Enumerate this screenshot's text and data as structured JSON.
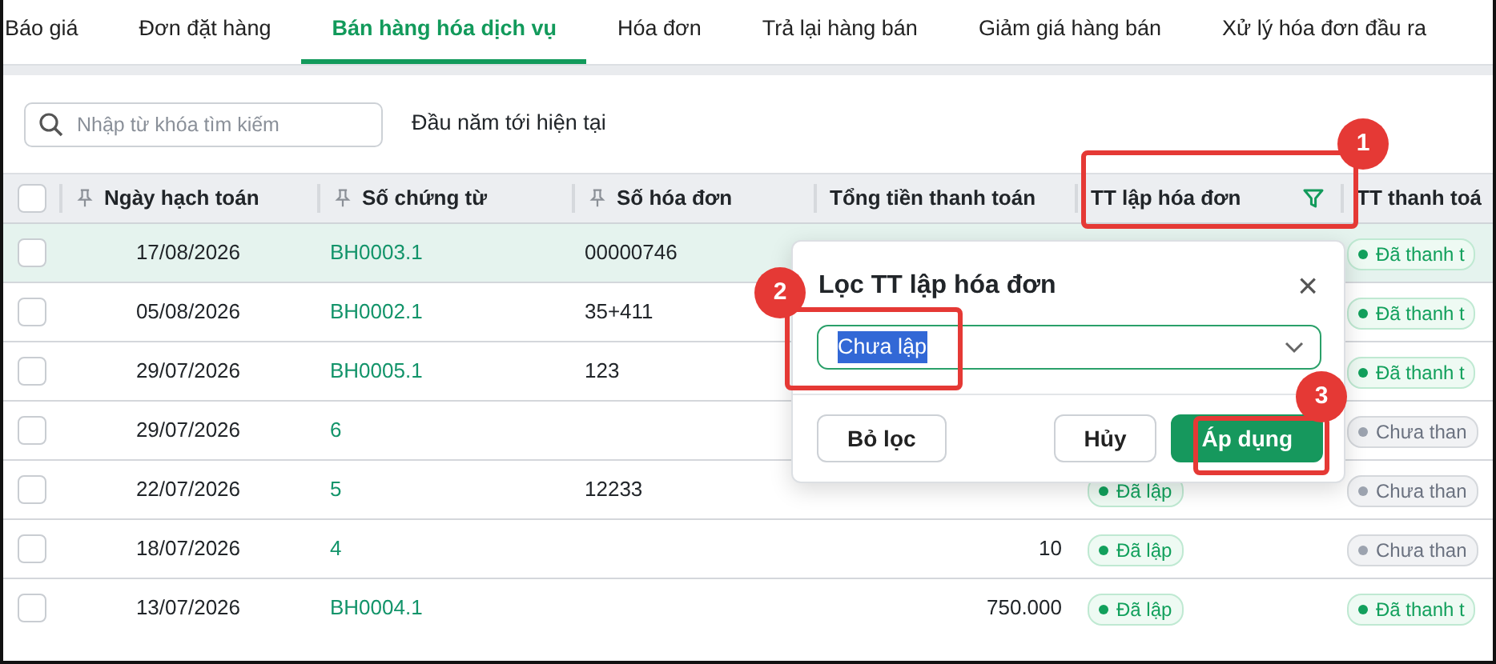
{
  "tabs": [
    {
      "label": "Báo giá",
      "selected": false
    },
    {
      "label": "Đơn đặt hàng",
      "selected": false
    },
    {
      "label": "Bán hàng hóa dịch vụ",
      "selected": true
    },
    {
      "label": "Hóa đơn",
      "selected": false
    },
    {
      "label": "Trả lại hàng bán",
      "selected": false
    },
    {
      "label": "Giảm giá hàng bán",
      "selected": false
    },
    {
      "label": "Xử lý hóa đơn đầu ra",
      "selected": false
    }
  ],
  "search": {
    "placeholder": "Nhập từ khóa tìm kiếm"
  },
  "period": "Đầu năm tới hiện tại",
  "table": {
    "select_all_checked": false,
    "columns": [
      {
        "label": "Ngày hạch toán",
        "pinned": true,
        "filtered": false
      },
      {
        "label": "Số chứng từ",
        "pinned": true,
        "filtered": false
      },
      {
        "label": "Số hóa đơn",
        "pinned": true,
        "filtered": false
      },
      {
        "label": "Tổng tiền thanh toán",
        "pinned": false,
        "filtered": false
      },
      {
        "label": "TT lập hóa đơn",
        "pinned": false,
        "filtered": true
      },
      {
        "label": "TT thanh toá",
        "pinned": false,
        "filtered": false
      }
    ],
    "rows": [
      {
        "selected": true,
        "checked": false,
        "date": "17/08/2026",
        "voucher": "BH0003.1",
        "invoice_no": "00000746",
        "payment": {
          "text": "Đã thanh t",
          "color": "#12a05c"
        }
      },
      {
        "selected": false,
        "checked": false,
        "date": "05/08/2026",
        "voucher": "BH0002.1",
        "invoice_no": "35+411",
        "payment": {
          "text": "Đã thanh t",
          "color": "#12a05c"
        }
      },
      {
        "selected": false,
        "checked": false,
        "date": "29/07/2026",
        "voucher": "BH0005.1",
        "invoice_no": "123",
        "payment": {
          "text": "Đã thanh t",
          "color": "#12a05c"
        }
      },
      {
        "selected": false,
        "checked": false,
        "date": "29/07/2026",
        "voucher": "6",
        "payment": {
          "text": "Chưa than",
          "color": "#9ca3af"
        }
      },
      {
        "selected": false,
        "checked": false,
        "date": "22/07/2026",
        "voucher": "5",
        "invoice_no": "12233",
        "invoice_status": {
          "text": "Đã lập",
          "color": "#12a05c"
        },
        "payment": {
          "text": "Chưa than",
          "color": "#9ca3af"
        }
      },
      {
        "selected": false,
        "checked": false,
        "date": "18/07/2026",
        "voucher": "4",
        "total": "10",
        "invoice_status": {
          "text": "Đã lập",
          "color": "#12a05c"
        },
        "payment": {
          "text": "Chưa than",
          "color": "#9ca3af"
        }
      },
      {
        "selected": false,
        "checked": false,
        "date": "13/07/2026",
        "voucher": "BH0004.1",
        "total": "750.000",
        "invoice_status": {
          "text": "Đã lập",
          "color": "#12a05c"
        },
        "payment": {
          "text": "Đã thanh t",
          "color": "#12a05c"
        }
      }
    ]
  },
  "filter_dialog": {
    "title": "Lọc TT lập hóa đơn",
    "close": "×",
    "value": "Chưa lập",
    "value_highlighted": true,
    "buttons": [
      {
        "label": "Bỏ lọc",
        "kind": "outline"
      },
      {
        "label": "Hủy",
        "kind": "outline"
      },
      {
        "label": "Áp dụng",
        "kind": "primary"
      }
    ]
  },
  "annotations": [
    {
      "label": "1"
    },
    {
      "label": "2"
    },
    {
      "label": "3"
    }
  ]
}
